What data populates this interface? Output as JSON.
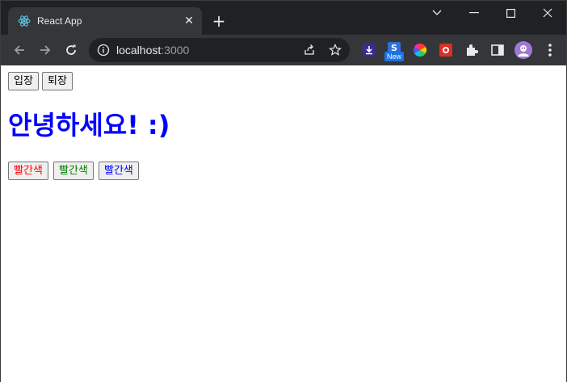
{
  "browser": {
    "tab_title": "React App",
    "url_host": "localhost",
    "url_port": ":3000",
    "extension_badge": "New"
  },
  "page": {
    "buttons_top": [
      "입장",
      "퇴장"
    ],
    "heading": "안녕하세요! :)",
    "heading_color": "#0000ff",
    "color_buttons": [
      {
        "label": "빨간색",
        "color": "#ff0000"
      },
      {
        "label": "빨간색",
        "color": "#008000"
      },
      {
        "label": "빨간색",
        "color": "#0000ff"
      }
    ]
  }
}
